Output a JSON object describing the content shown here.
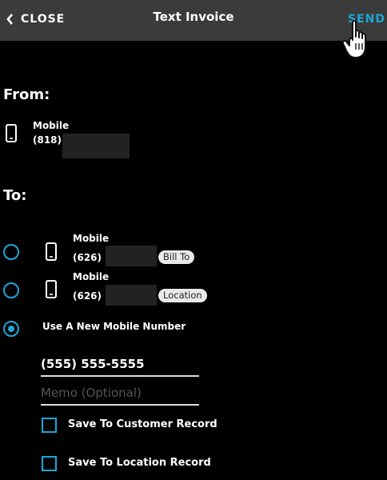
{
  "header": {
    "close_label": "CLOSE",
    "title": "Text Invoice",
    "send_label": "SEND"
  },
  "from": {
    "heading": "From:",
    "contact": {
      "type": "Mobile",
      "area_code": "(818)",
      "icon": "mobile-phone-icon"
    }
  },
  "to": {
    "heading": "To:",
    "options": [
      {
        "type": "Mobile",
        "area_code": "(626)",
        "badge": "Bill To",
        "selected": false
      },
      {
        "type": "Mobile",
        "area_code": "(626)",
        "badge": "Location",
        "selected": false
      }
    ],
    "new_number": {
      "label": "Use A New Mobile Number",
      "selected": true,
      "phone_value": "(555) 555-5555",
      "memo_placeholder": "Memo (Optional)"
    },
    "checkboxes": [
      {
        "label": "Save To Customer Record",
        "checked": false
      },
      {
        "label": "Save To Location Record",
        "checked": false
      }
    ]
  },
  "colors": {
    "accent": "#1aa7d9",
    "header_bg": "#3b3b3b",
    "background": "#000000",
    "badge_bg": "#e9e9e9"
  }
}
